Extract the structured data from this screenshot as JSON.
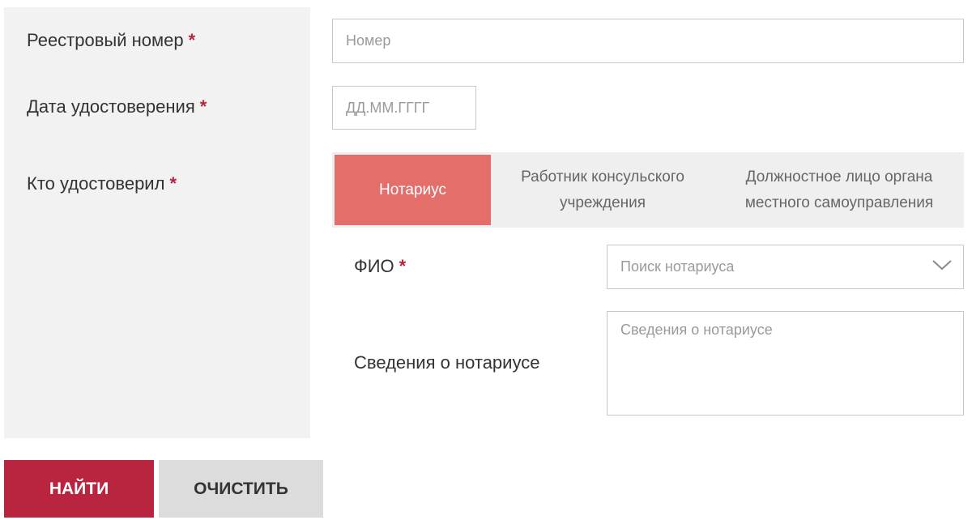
{
  "form": {
    "registry_number": {
      "label": "Реестровый номер",
      "required_mark": "*",
      "placeholder": "Номер",
      "value": ""
    },
    "certification_date": {
      "label": "Дата удостоверения",
      "required_mark": "*",
      "placeholder": "ДД.ММ.ГГГГ",
      "value": ""
    },
    "certified_by": {
      "label": "Кто удостоверил",
      "required_mark": "*",
      "tabs": [
        {
          "label": "Нотариус",
          "active": true
        },
        {
          "label_line1": "Работник консульского",
          "label_line2": "учреждения",
          "active": false
        },
        {
          "label_line1": "Должностное лицо органа",
          "label_line2": "местного самоуправления",
          "active": false
        }
      ]
    },
    "fio": {
      "label": "ФИО",
      "required_mark": "*",
      "placeholder": "Поиск нотариуса",
      "icon": "chevron-down-icon"
    },
    "notary_info": {
      "label": "Сведения о нотариусе",
      "placeholder": "Сведения о нотариусе"
    }
  },
  "actions": {
    "find_label": "НАЙТИ",
    "clear_label": "ОЧИСТИТЬ"
  },
  "colors": {
    "accent": "#b9253f",
    "active_tab": "#e46e69",
    "panel_bg": "#f2f2f2",
    "required": "#b5253e"
  }
}
